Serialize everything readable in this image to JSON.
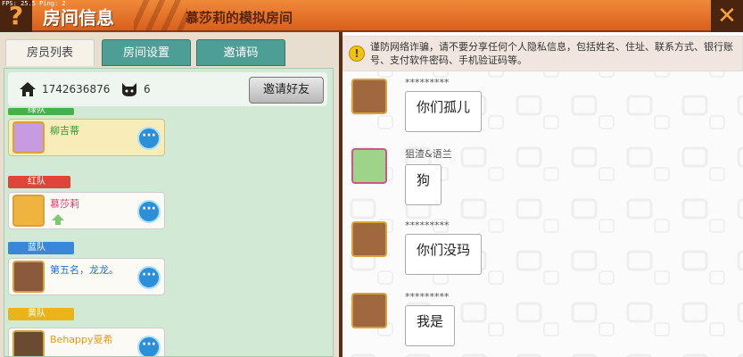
{
  "header": {
    "fps": "FPS: 25.5 Ping: 2",
    "title": "房间信息",
    "room_name": "慕莎莉的模拟房间",
    "help_label": "?",
    "close_label": "✕"
  },
  "tabs": [
    {
      "label": "房员列表",
      "active": true
    },
    {
      "label": "房间设置",
      "active": false
    },
    {
      "label": "邀请码",
      "active": false
    }
  ],
  "room_info": {
    "room_id": "1742636876",
    "member_count": "6",
    "invite_button": "邀请好友"
  },
  "teams": [
    {
      "label": "绿队",
      "color": "#46b04a"
    },
    {
      "label": "红队",
      "color": "#e0453a"
    },
    {
      "label": "蓝队",
      "color": "#3a86d8"
    },
    {
      "label": "黄队",
      "color": "#e8b41a"
    }
  ],
  "members": [
    {
      "name": "柳吉蒂",
      "name_color": "#2e9a36",
      "team": "绿队",
      "highlight": true
    },
    {
      "name": "慕莎莉",
      "name_color": "#d63c6a",
      "team": "红队",
      "highlight": false
    },
    {
      "name": "第五名，龙龙。",
      "name_color": "#2a6fd0",
      "team": "蓝队",
      "highlight": false
    },
    {
      "name": "Behappy夏希",
      "name_color": "#e29a12",
      "team": "黄队",
      "highlight": false
    }
  ],
  "more_label": "···",
  "warning": "谨防网络诈骗，请不要分享任何个人隐私信息，包括姓名、住址、联系方式、银行账号、支付软件密码、手机验证码等。",
  "warning_icon_label": "!",
  "messages": [
    {
      "sender": "*********",
      "text": "你们孤儿"
    },
    {
      "sender": "狙渣&语兰",
      "text": "狗"
    },
    {
      "sender": "*********",
      "text": "你们没玛"
    },
    {
      "sender": "*********",
      "text": "我是"
    }
  ],
  "colors": {
    "header_orange": "#e5742a",
    "panel_green": "#d2e9d5",
    "tab_teal": "#4d9e95",
    "more_blue": "#2c8fd8"
  },
  "icons": {
    "help": "question-icon",
    "close": "close-icon",
    "home": "home-icon",
    "members": "cat-head-icon",
    "more": "ellipsis-icon",
    "warning": "warning-icon",
    "promote": "up-arrow-icon"
  }
}
